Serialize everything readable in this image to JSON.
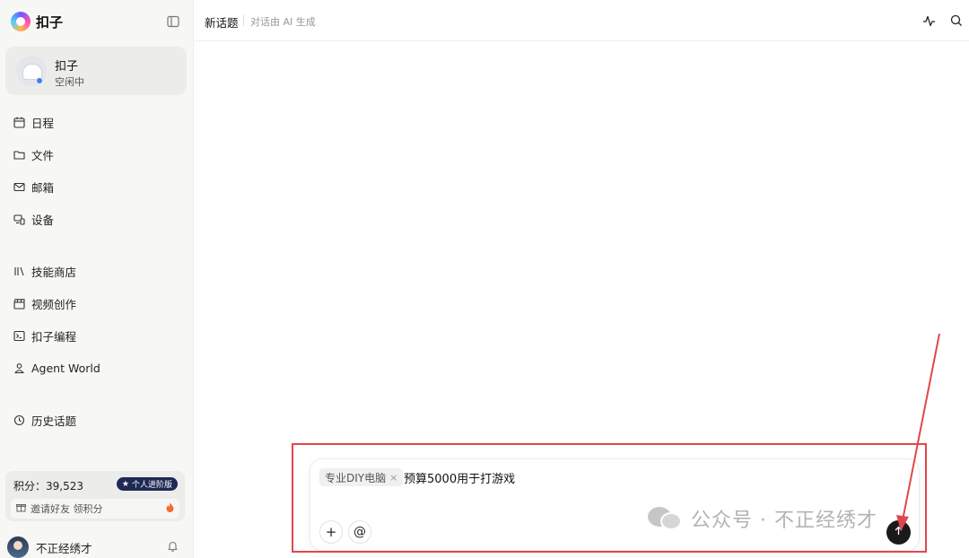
{
  "app": {
    "name": "扣子"
  },
  "agent": {
    "name": "扣子",
    "status": "空闲中"
  },
  "nav_primary": [
    {
      "label": "日程",
      "icon": "calendar-icon"
    },
    {
      "label": "文件",
      "icon": "folder-icon"
    },
    {
      "label": "邮箱",
      "icon": "mail-icon"
    },
    {
      "label": "设备",
      "icon": "devices-icon"
    }
  ],
  "nav_secondary": [
    {
      "label": "技能商店",
      "icon": "library-icon"
    },
    {
      "label": "视频创作",
      "icon": "clapperboard-icon"
    },
    {
      "label": "扣子编程",
      "icon": "terminal-icon"
    },
    {
      "label": "Agent World",
      "icon": "agent-world-icon"
    }
  ],
  "nav_history": {
    "label": "历史话题",
    "icon": "history-icon"
  },
  "points": {
    "label": "积分：39,523",
    "badge": "个人进阶版",
    "invite": "邀请好友 领积分"
  },
  "user": {
    "name": "不正经绣才"
  },
  "header": {
    "title": "新话题",
    "subtitle": "对话由 AI 生成"
  },
  "composer": {
    "chip_label": "专业DIY电脑",
    "chip_close": "×",
    "text": "预算5000用于打游戏",
    "add_label": "+",
    "mention_label": "@"
  },
  "watermark": {
    "text": "公众号 · 不正经绣才"
  },
  "colors": {
    "accent_dark": "#1a1a1a",
    "status_blue": "#3b82f6",
    "highlight_red": "#e0474c",
    "badge_navy": "#1e2a55"
  }
}
